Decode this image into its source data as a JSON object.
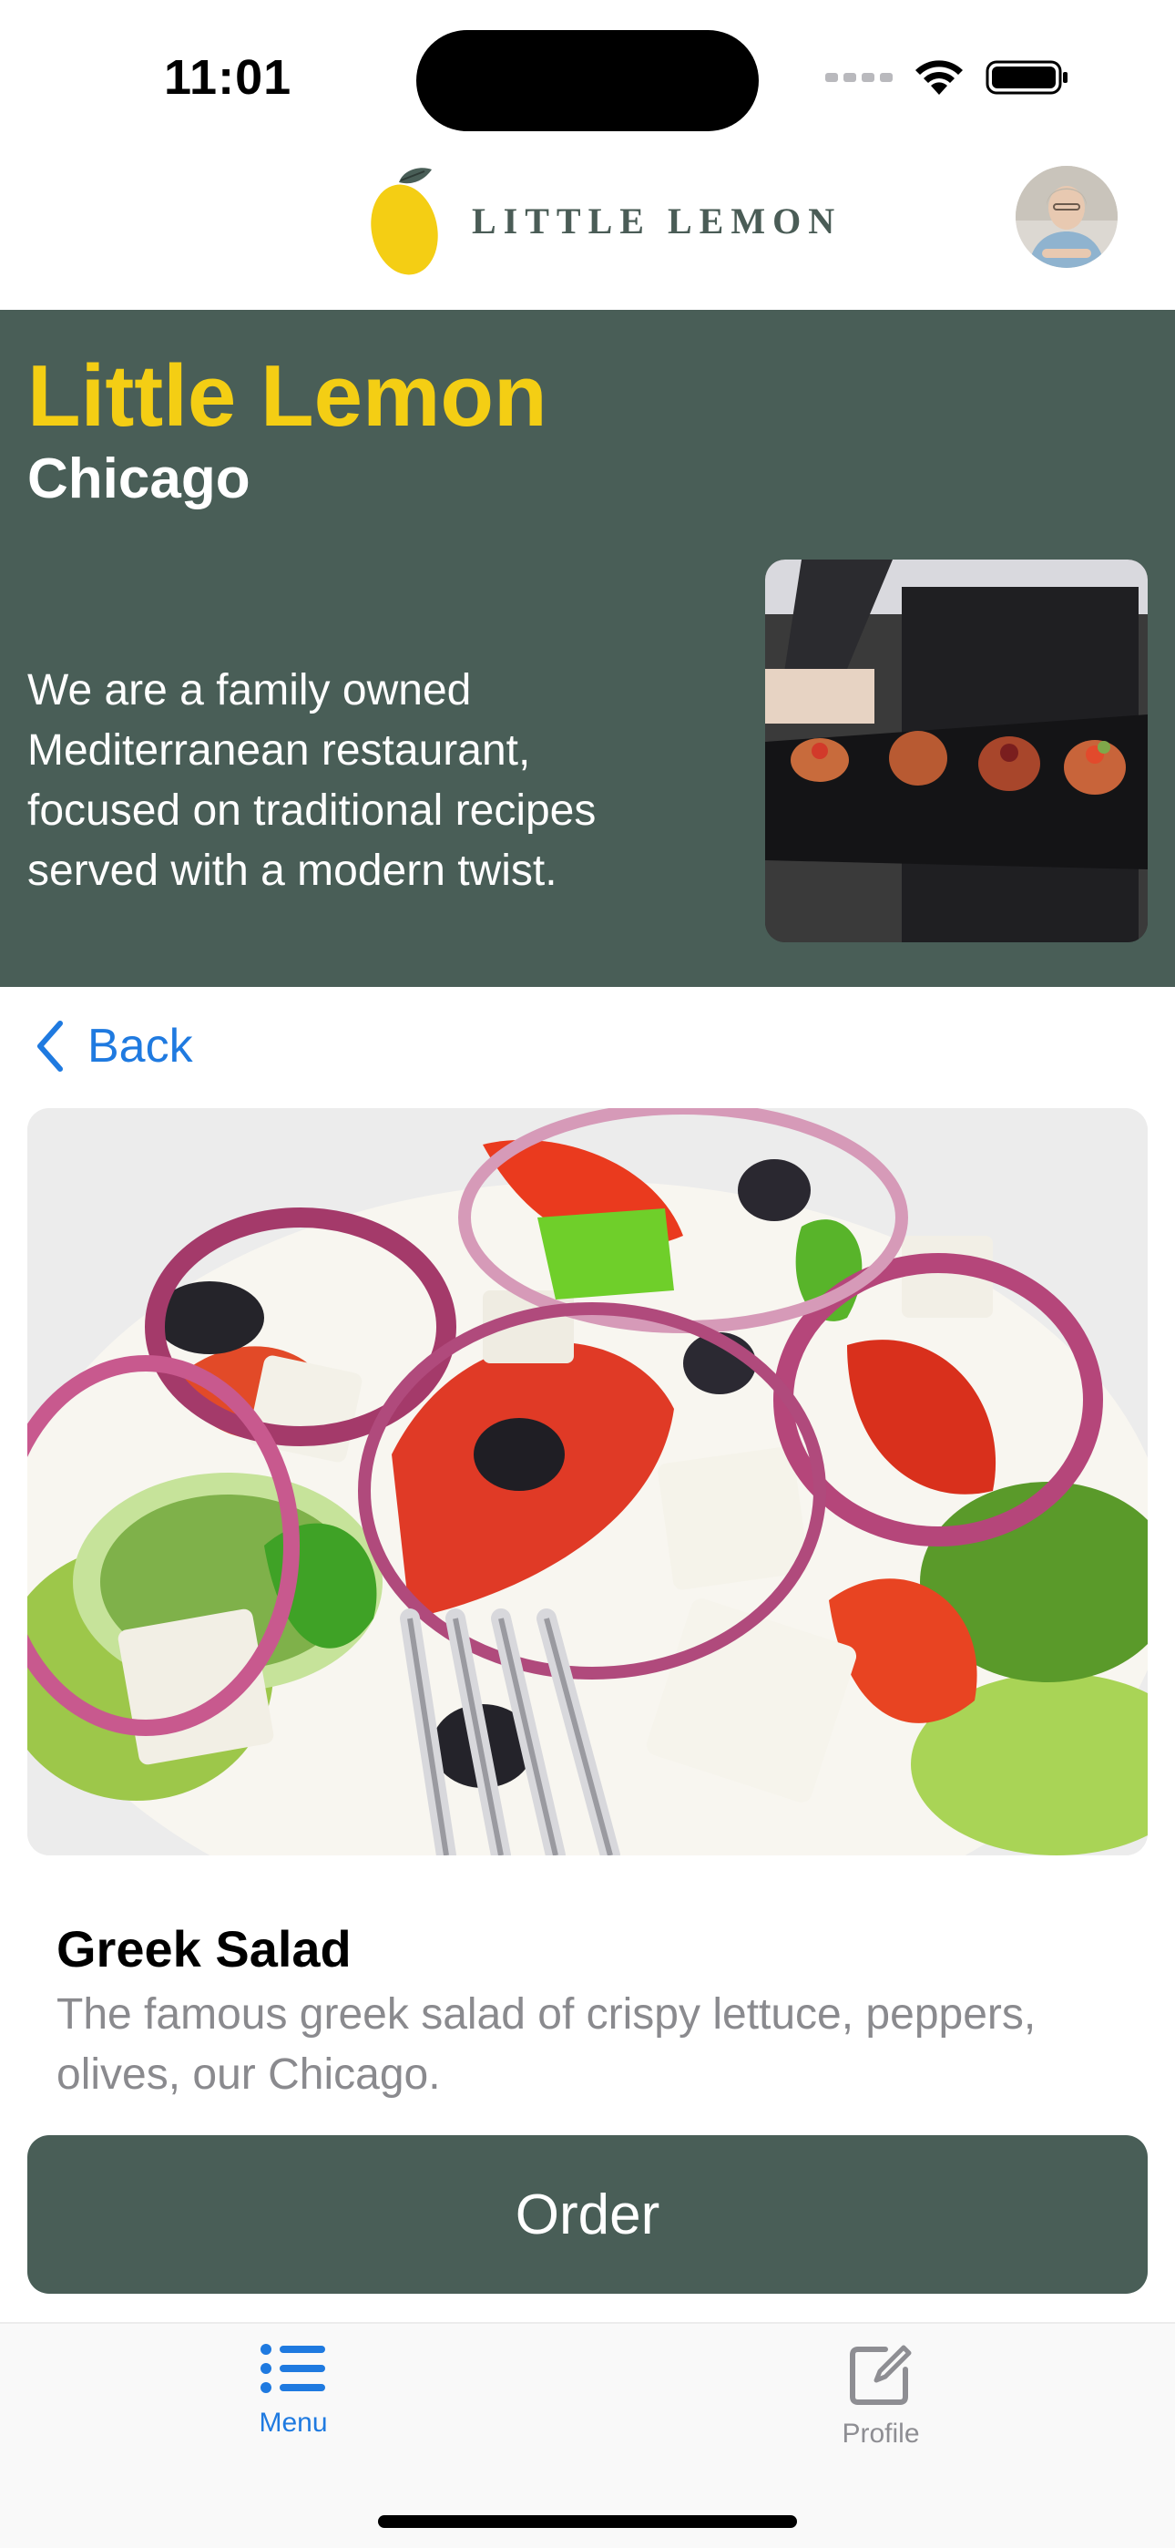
{
  "status_bar": {
    "time": "11:01"
  },
  "header": {
    "logo_text": "LITTLE LEMON",
    "logo_icon": "lemon-icon",
    "avatar_icon": "profile-avatar"
  },
  "hero": {
    "title": "Little Lemon",
    "subtitle": "Chicago",
    "description": "We are a family owned Mediterranean restaurant, focused on traditional recipes served with a modern twist."
  },
  "navigation": {
    "back_label": "Back",
    "back_icon": "chevron-left-icon"
  },
  "dish": {
    "name": "Greek Salad",
    "description": "The famous greek salad of crispy lettuce, peppers, olives, our Chicago."
  },
  "actions": {
    "order_label": "Order"
  },
  "tab_bar": {
    "tabs": [
      {
        "label": "Menu",
        "icon": "list-icon",
        "selected": true
      },
      {
        "label": "Profile",
        "icon": "edit-icon",
        "selected": false
      }
    ]
  },
  "colors": {
    "primary_green": "#495e57",
    "primary_yellow": "#f4ce14",
    "link_blue": "#1f7ae0",
    "inactive_gray": "#8e8e93"
  }
}
